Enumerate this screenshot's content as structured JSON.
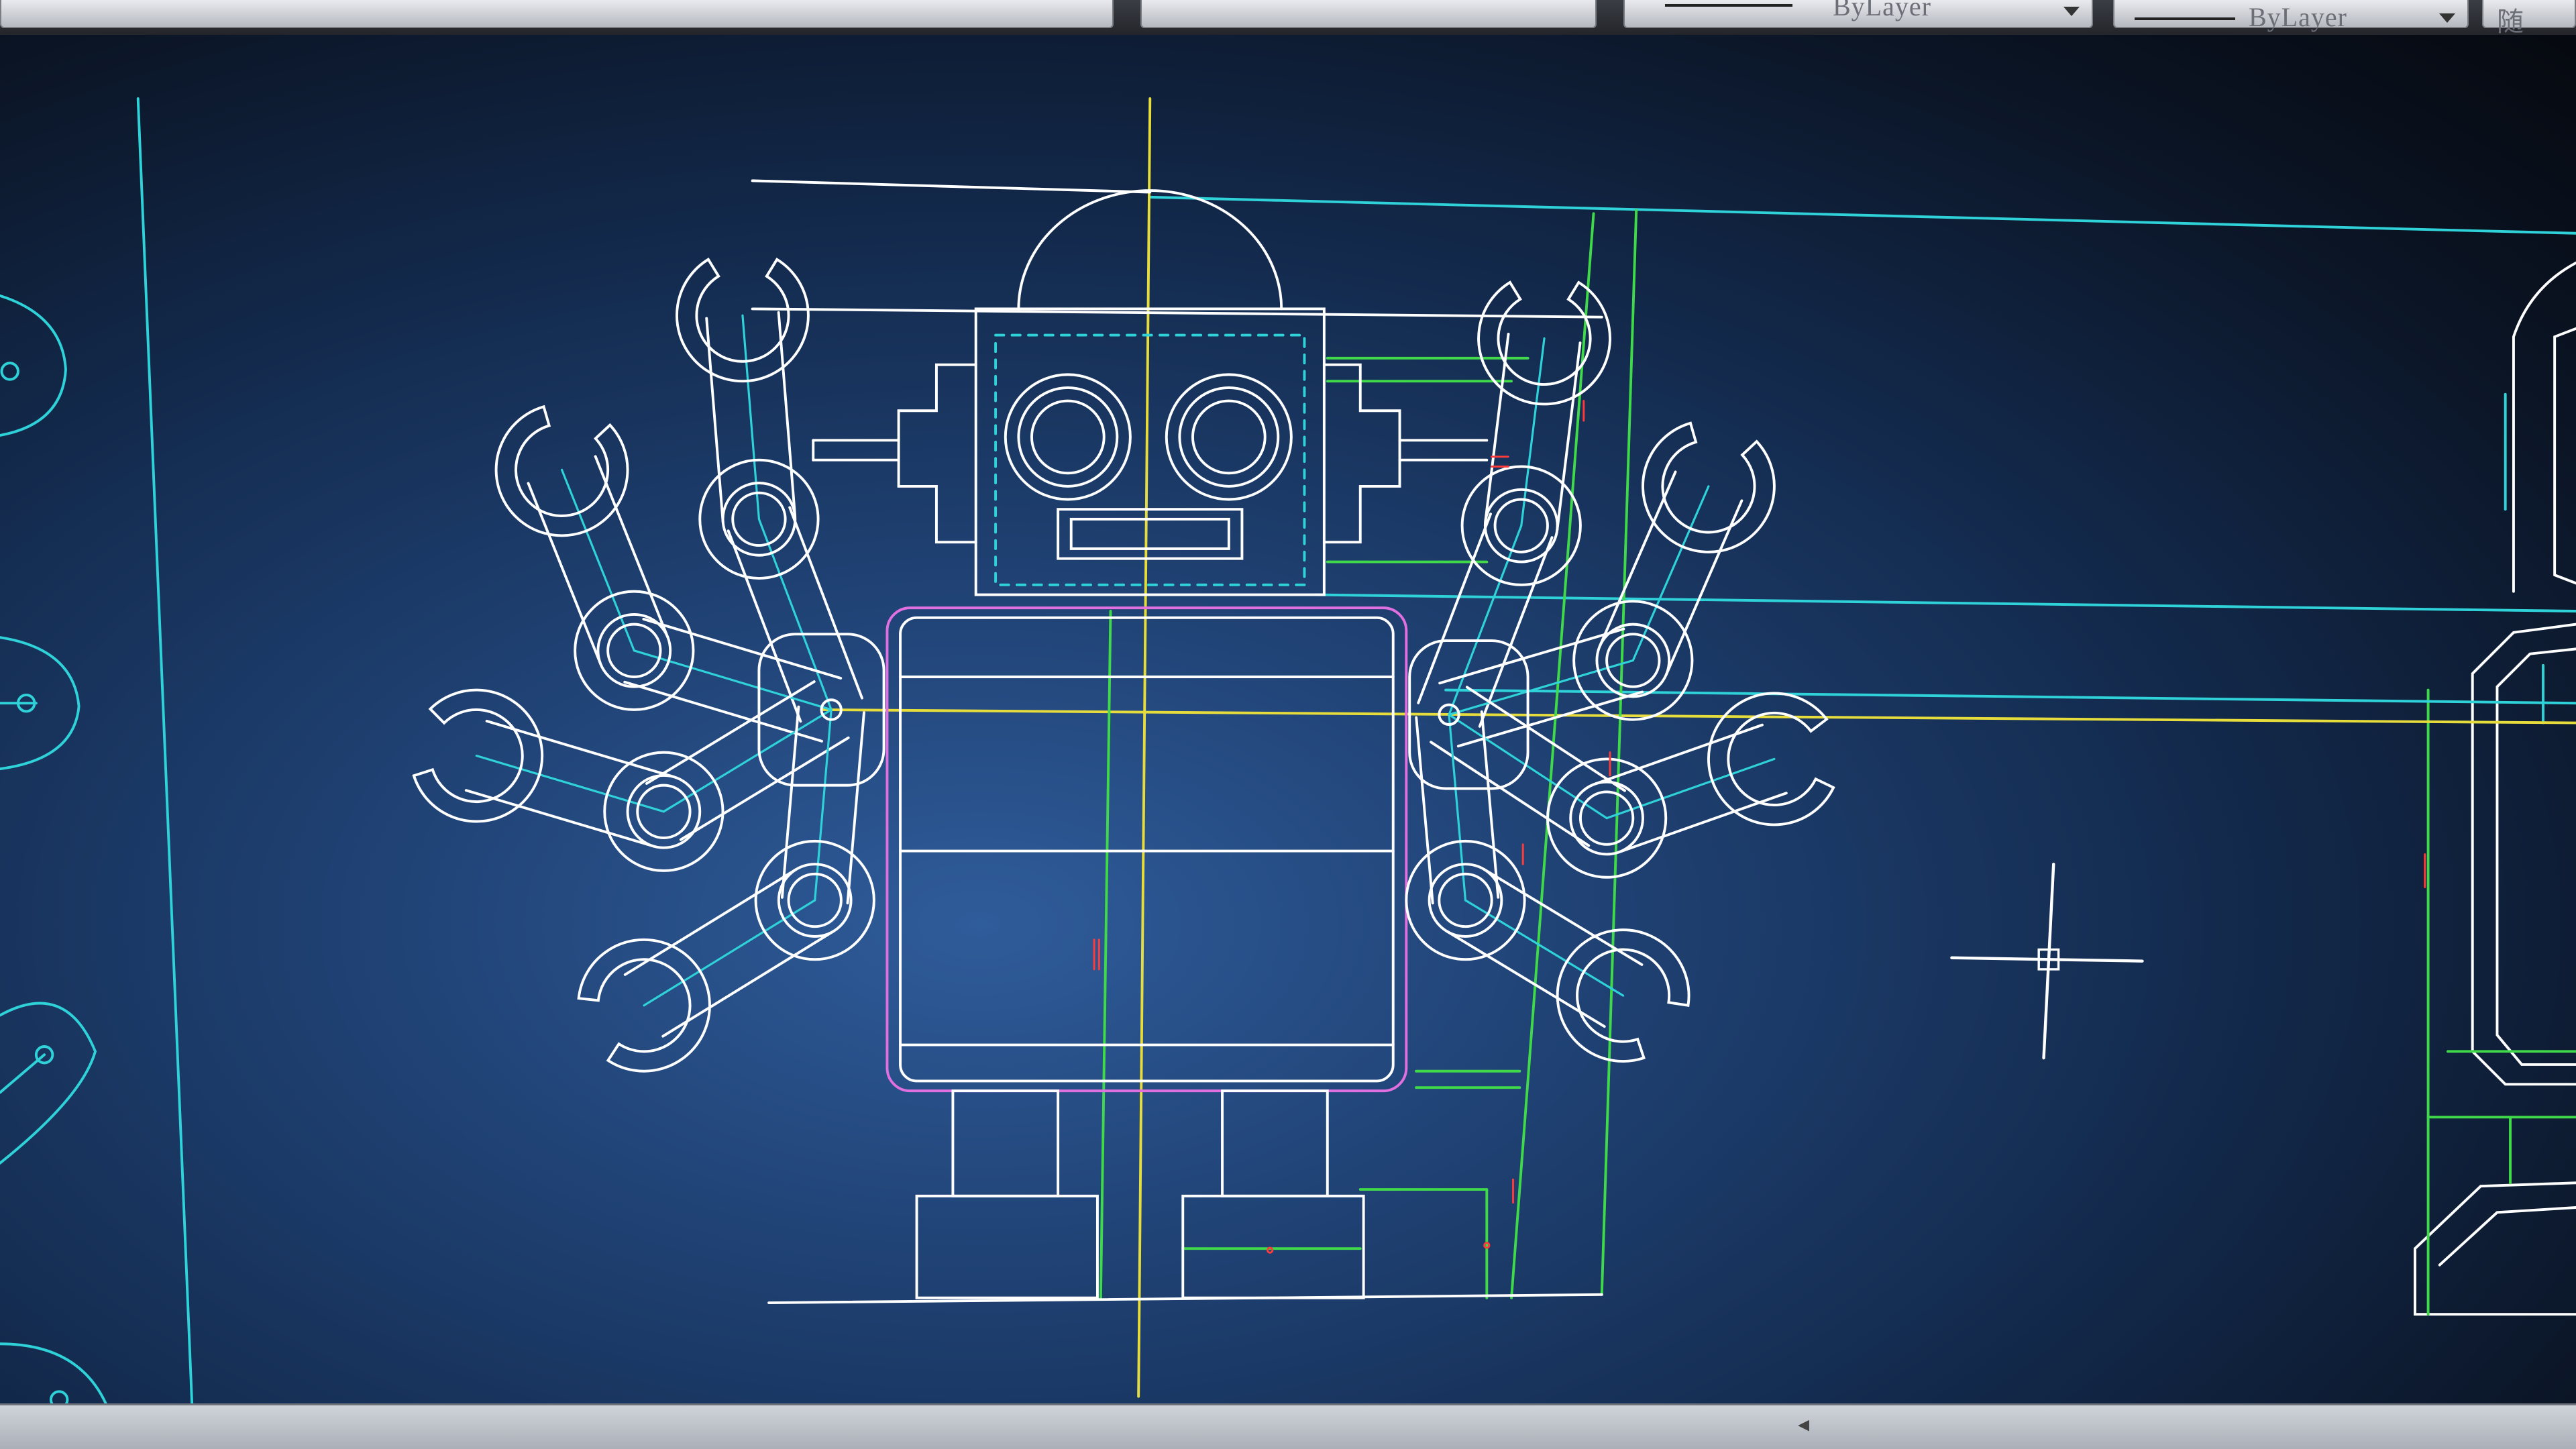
{
  "toolbar": {
    "color_value": "ByLayer",
    "linetype_value": "ByLayer",
    "lineweight_value": "ByLayer",
    "plotstyle_partial": "随"
  },
  "colors": {
    "background": "#1f4173",
    "geometry": "#ffffff",
    "construction_cyan": "#2fd2d8",
    "guide_yellow": "#e6dc3c",
    "guide_green": "#3fd94a",
    "magenta": "#e070e0",
    "dimension_red": "#ff3a3a"
  },
  "icons": {
    "crosshair": "crosshair-cursor-icon",
    "combo_dropdown": "chevron-down-icon",
    "scroll": "scroll-left-icon"
  }
}
